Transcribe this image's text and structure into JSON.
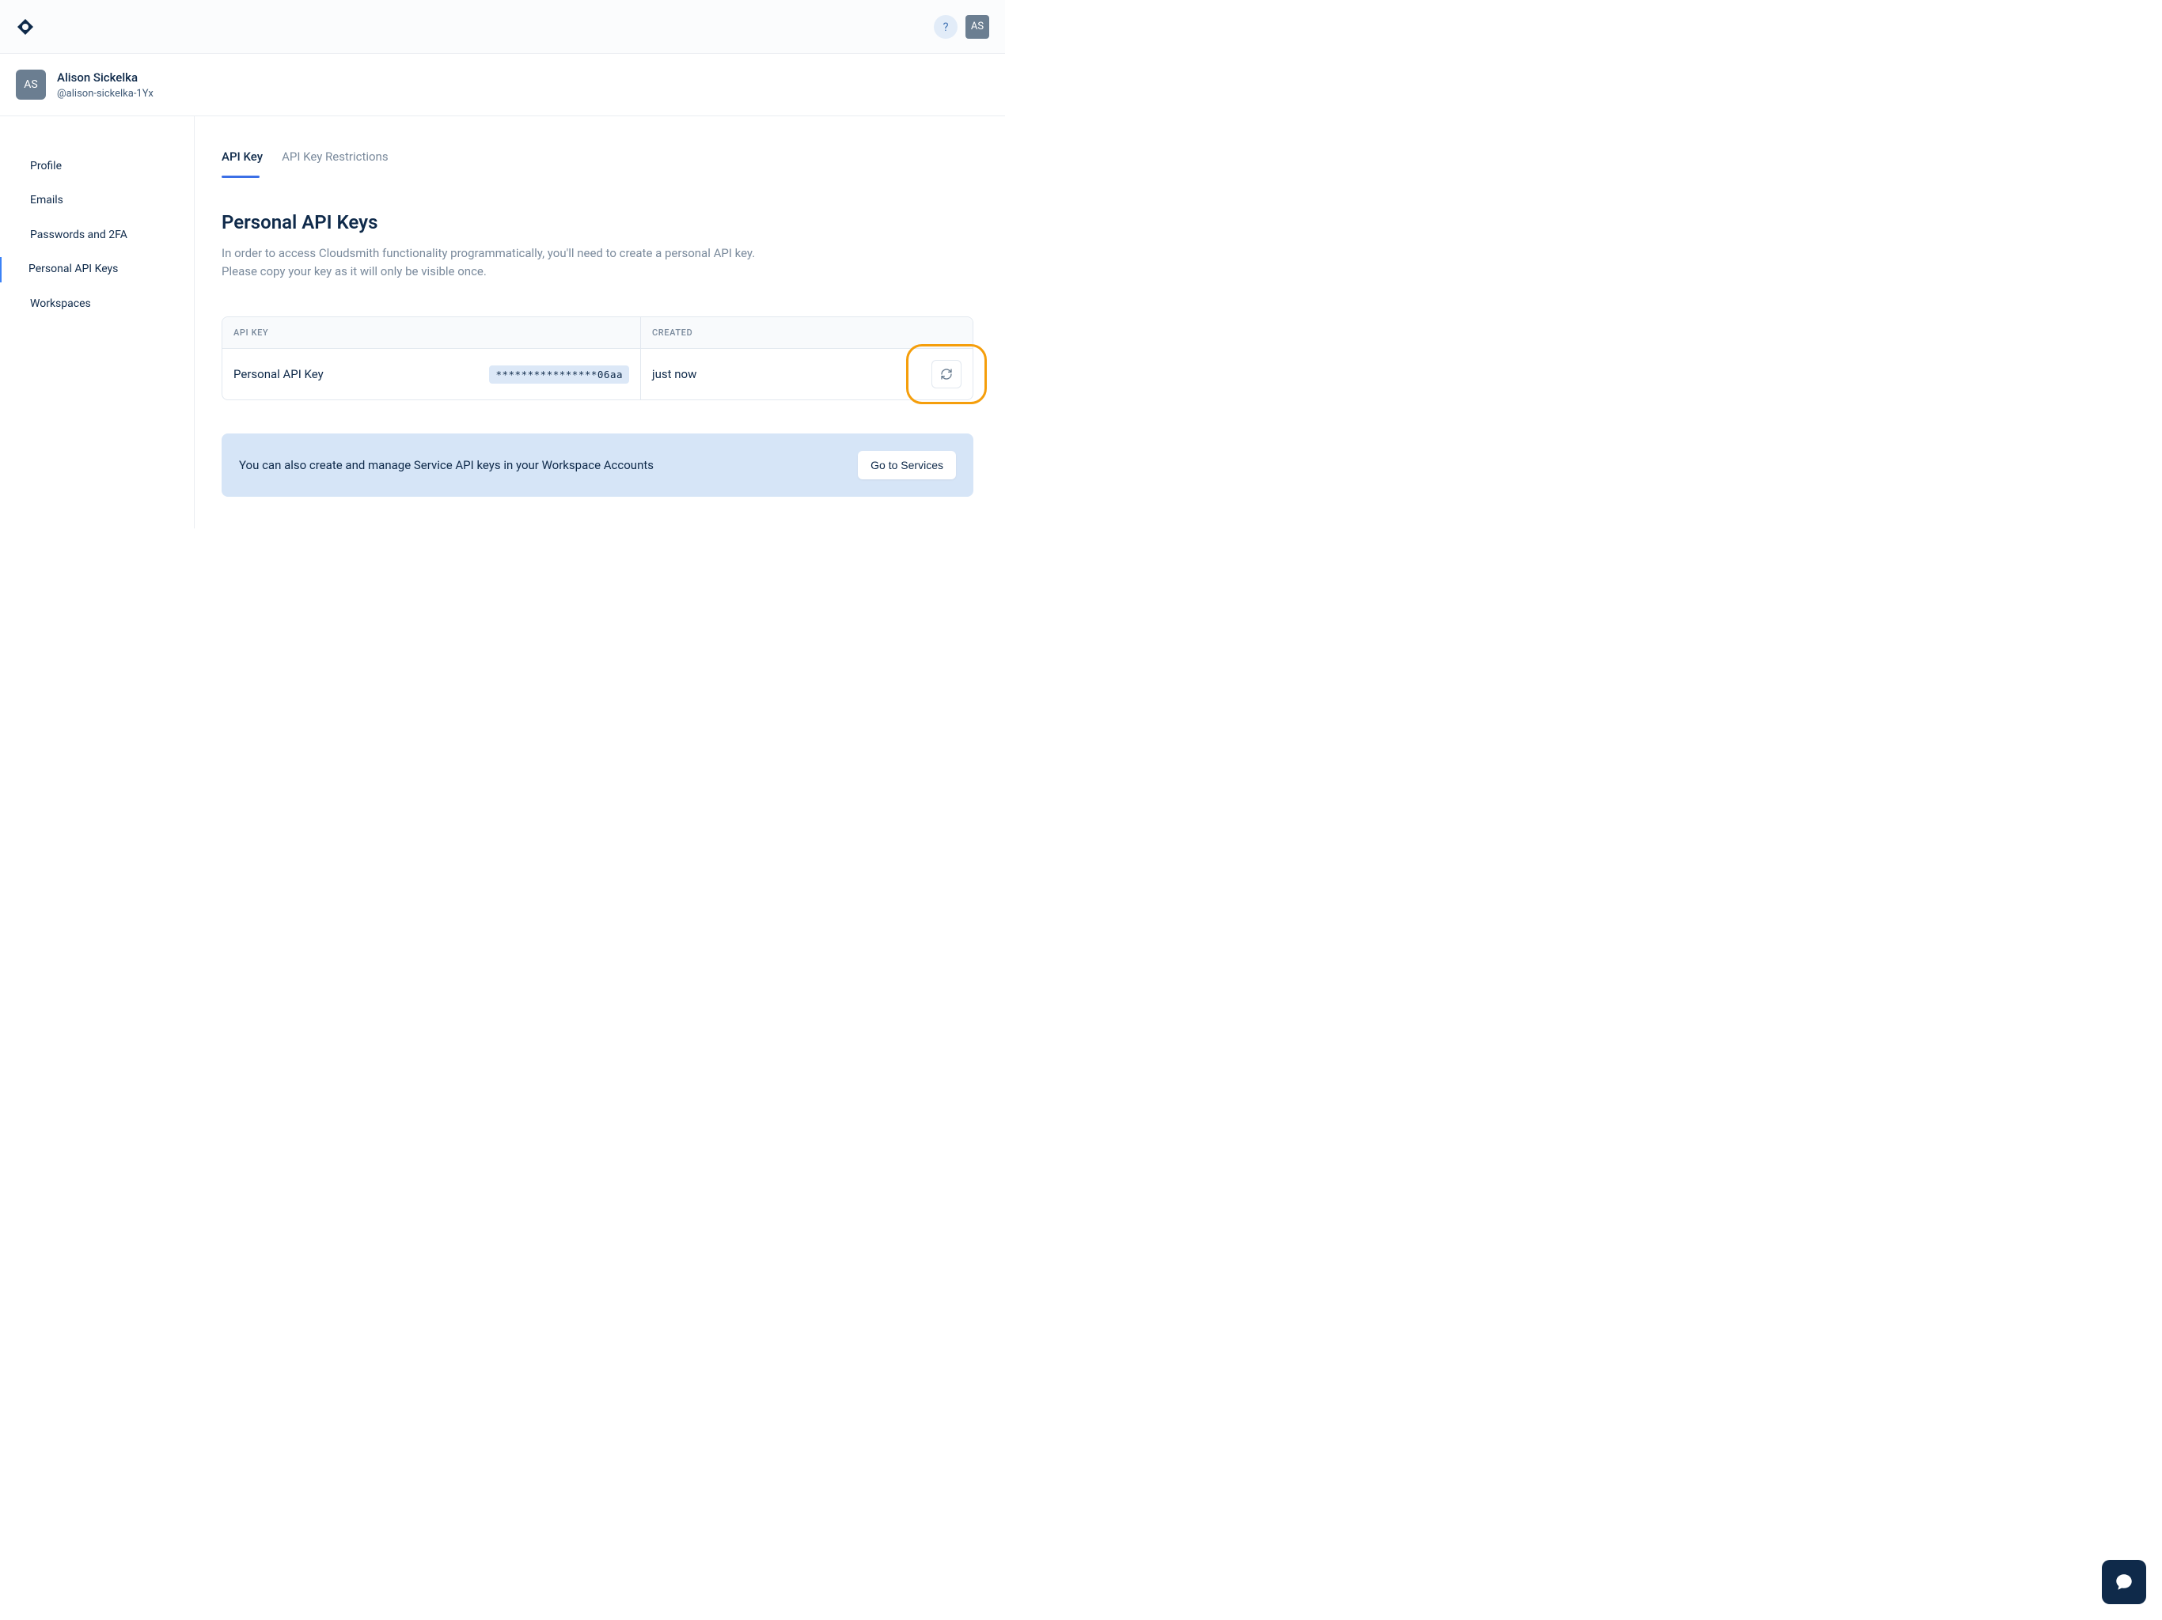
{
  "header": {
    "avatar_initials": "AS",
    "user_name": "Alison Sickelka",
    "user_handle": "@alison-sickelka-1Yx"
  },
  "sidebar": {
    "items": [
      {
        "label": "Profile"
      },
      {
        "label": "Emails"
      },
      {
        "label": "Passwords and 2FA"
      },
      {
        "label": "Personal API Keys"
      },
      {
        "label": "Workspaces"
      }
    ]
  },
  "tabs": [
    {
      "label": "API Key"
    },
    {
      "label": "API Key Restrictions"
    }
  ],
  "page": {
    "title": "Personal API Keys",
    "description": "In order to access Cloudsmith functionality programmatically, you'll need to create a personal API key. Please copy your key as it will only be visible once."
  },
  "table": {
    "headers": {
      "key": "API KEY",
      "created": "CREATED"
    },
    "rows": [
      {
        "name": "Personal API Key",
        "value": "****************06aa",
        "created": "just now"
      }
    ]
  },
  "banner": {
    "text": "You can also create and manage Service API keys in your Workspace Accounts",
    "button": "Go to Services"
  },
  "help_label": "?"
}
